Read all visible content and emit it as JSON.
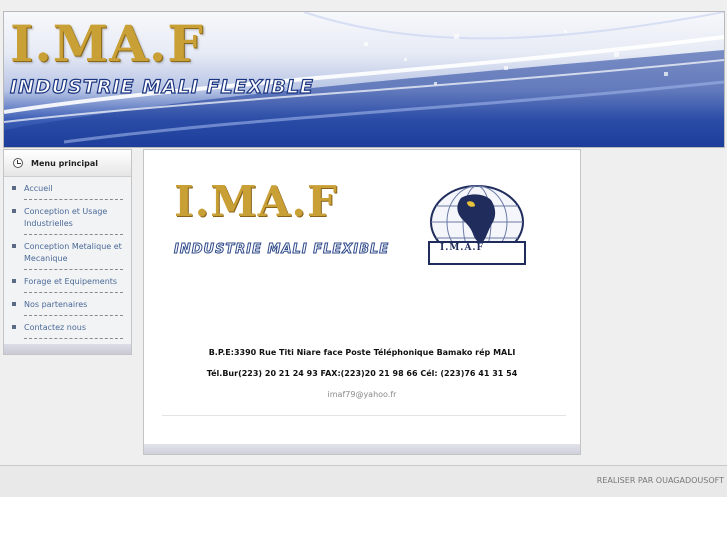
{
  "header": {
    "title": "I.MA.F",
    "subtitle": "INDUSTRIE MALI FLEXIBLE"
  },
  "sidebar": {
    "title": "Menu principal",
    "items": [
      {
        "label": "Accueil"
      },
      {
        "label": "Conception et Usage Industrielles"
      },
      {
        "label": "Conception Metalique et Mecanique"
      },
      {
        "label": "Forage et Equipements"
      },
      {
        "label": "Nos partenaires"
      },
      {
        "label": "Contactez nous"
      }
    ]
  },
  "main": {
    "logo_title": "I.MA.F",
    "logo_subtitle": "INDUSTRIE MALI FLEXIBLE",
    "globe_label": "I.M.A.F",
    "address": "B.P.E:3390 Rue Titi Niare face Poste Téléphonique Bamako rép MALI",
    "phones": "Tél.Bur(223) 20 21 24 93 FAX:(223)20 21 98 66 Cél: (223)76 41 31 54",
    "email": "imaf79@yahoo.fr"
  },
  "footer": {
    "credit": "REALISER PAR OUAGADOUSOFT"
  },
  "icons": {
    "menu_header": "clock-icon",
    "menu_item": "square-bullet-icon"
  },
  "colors": {
    "gold": "#c9a035",
    "banner_blue": "#1c3d98",
    "link": "#4b6a97"
  }
}
